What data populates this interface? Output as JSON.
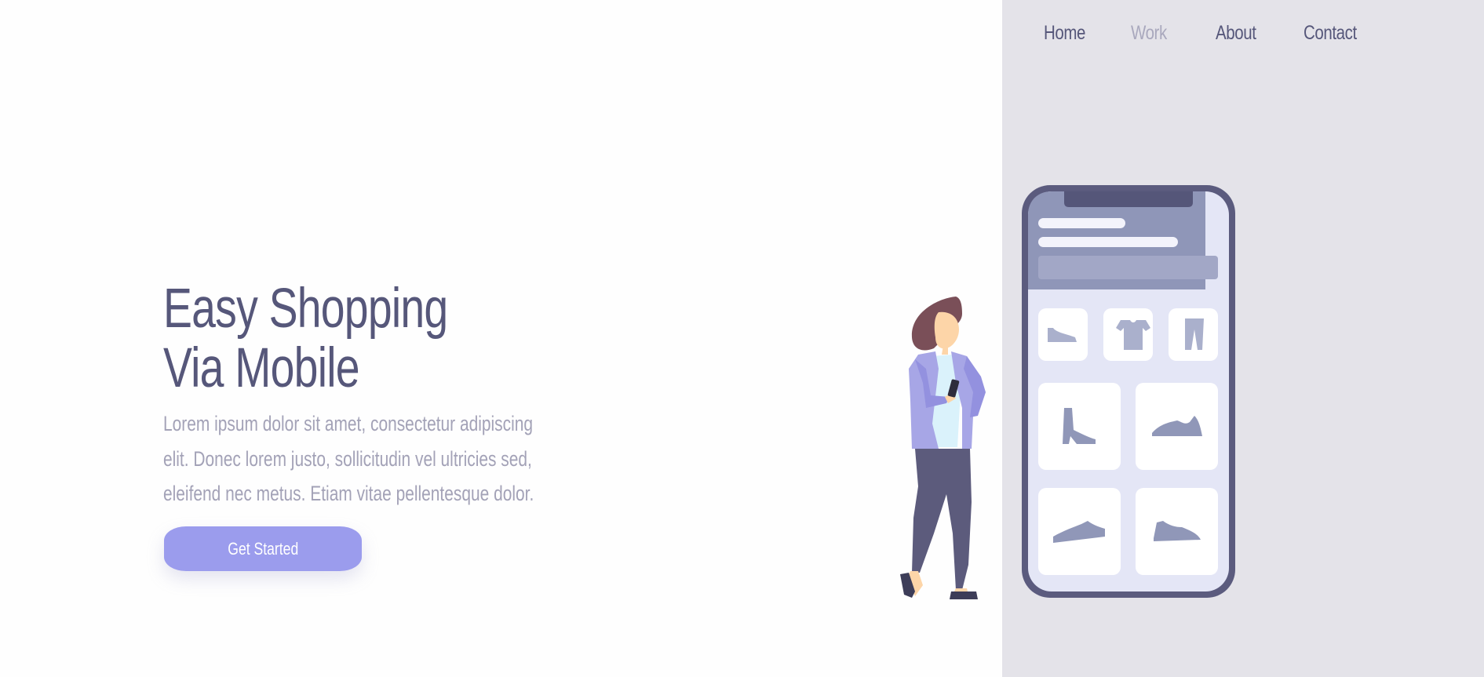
{
  "nav": {
    "items": [
      {
        "label": "Home",
        "active": false
      },
      {
        "label": "Work",
        "active": true
      },
      {
        "label": "About",
        "active": false
      },
      {
        "label": "Contact",
        "active": false
      }
    ]
  },
  "hero": {
    "title_line1": "Easy Shopping",
    "title_line2": "Via Mobile",
    "description": "Lorem ipsum dolor sit amet, consectetur adipiscing elit. Donec lorem justo, sollicitudin vel ultricies sed, eleifend nec metus. Etiam vitae pellentesque dolor.",
    "cta_label": "Get Started"
  },
  "illustration": {
    "icons": [
      "shoe-icon",
      "tshirt-icon",
      "pants-icon",
      "boot-icon",
      "sneaker-icon",
      "sneaker-icon",
      "sneaker-icon"
    ]
  },
  "colors": {
    "primary_text": "#56577a",
    "muted_text": "#a3a2b7",
    "accent": "#9b9ced",
    "panel_bg": "#e4e3e9",
    "phone_frame": "#5b5b7e"
  }
}
